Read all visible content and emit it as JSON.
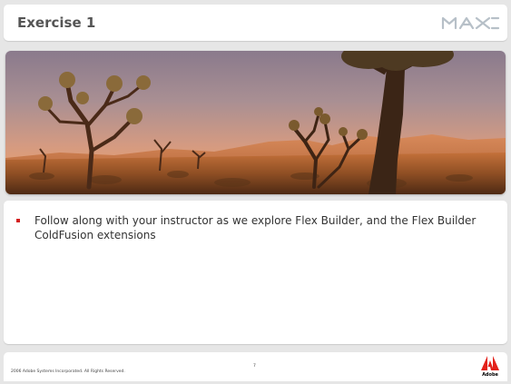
{
  "slide": {
    "title": "Exercise 1",
    "logo_text": "MAX",
    "bullets": [
      "Follow along with your instructor as we explore Flex Builder, and the Flex Builder ColdFusion extensions"
    ],
    "footer": {
      "copyright": "2006 Adobe Systems Incorporated.  All Rights Reserved.",
      "page_number": "7",
      "brand": "Adobe"
    }
  },
  "colors": {
    "bullet": "#d42020",
    "title": "#555555",
    "adobe_red": "#e3221b"
  },
  "icons": {
    "max_logo": "max-conference-logo",
    "adobe_logo": "adobe-logo",
    "banner": "joshua-tree-desert-photo"
  }
}
